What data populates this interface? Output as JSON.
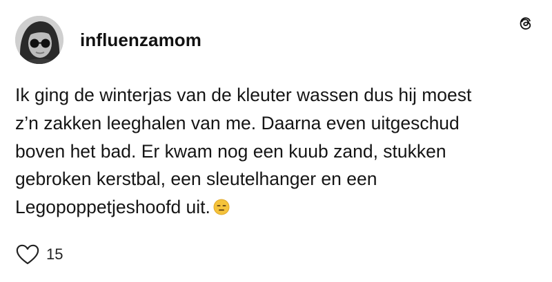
{
  "post": {
    "username": "influenzamom",
    "text_lines": [
      "Ik ging de winterjas van de kleuter wassen dus hij moest",
      "z’n zakken leeghalen van me. Daarna even uitgeschud",
      "boven het bad. Er kwam nog een kuub zand, stukken",
      "gebroken kerstbal, een sleutelhanger en een",
      "Legopoppetjeshoofd uit."
    ],
    "emoji": "expressionless-face",
    "like_count": "15"
  },
  "icons": {
    "brand": "threads-logo-icon",
    "like": "heart-icon"
  },
  "colors": {
    "text": "#111111",
    "emoji_face": "#f5c33b"
  }
}
